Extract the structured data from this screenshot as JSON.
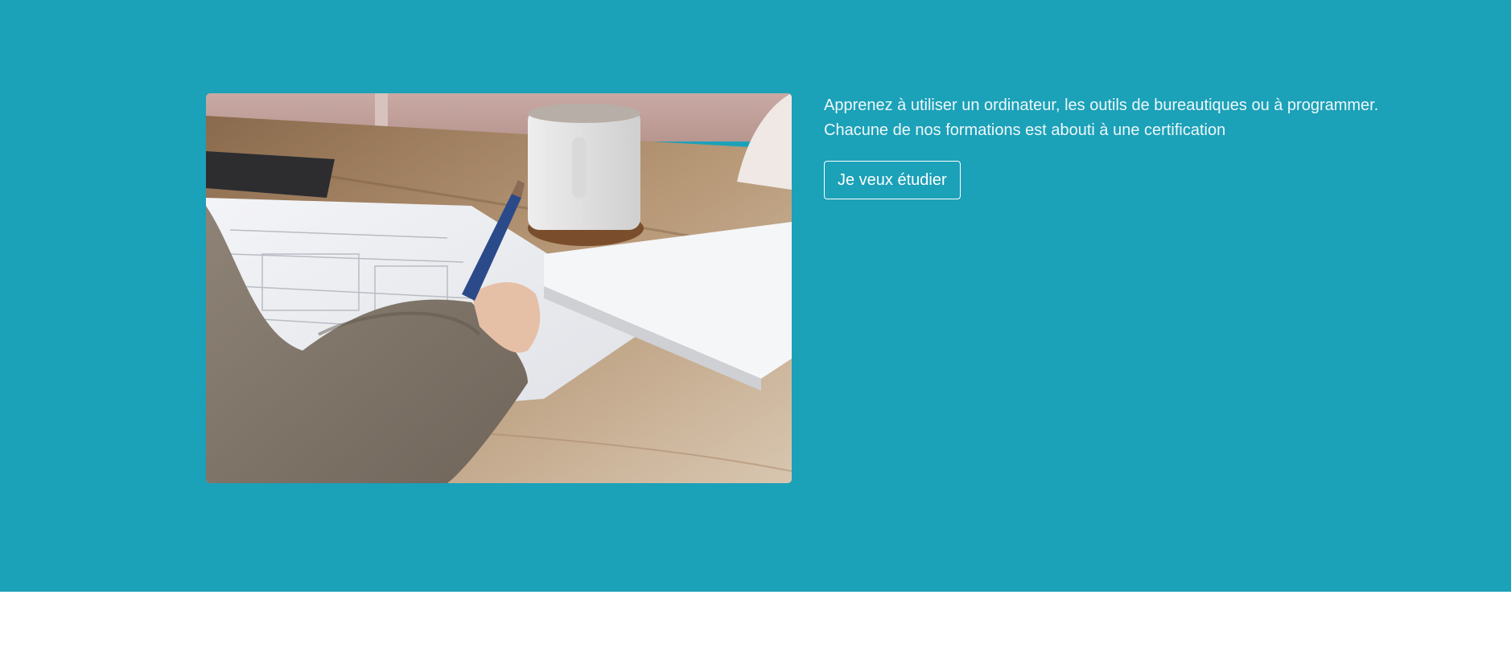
{
  "hero": {
    "background_color": "#1ba1b8",
    "image_icon": "photo-writing-at-desk-icon",
    "description": "Apprenez à utiliser un ordinateur, les outils de bureautiques ou à programmer. Chacune de nos formations est abouti à une certification",
    "cta_label": "Je veux étudier"
  }
}
